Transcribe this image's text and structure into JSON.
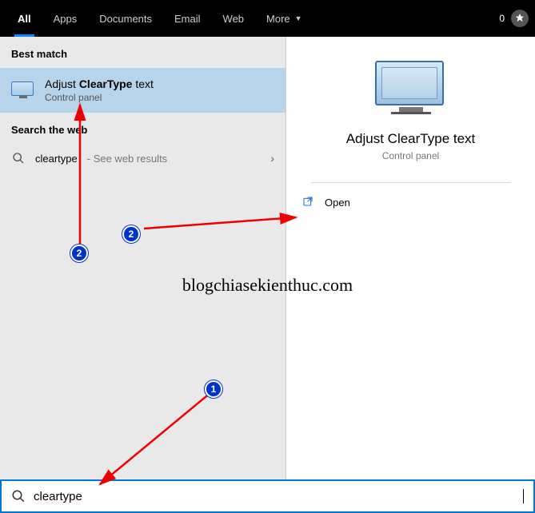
{
  "nav": {
    "tabs": [
      "All",
      "Apps",
      "Documents",
      "Email",
      "Web",
      "More"
    ],
    "active_index": 0,
    "count": "0"
  },
  "left": {
    "best_match_header": "Best match",
    "best_match": {
      "title_pre": "Adjust ",
      "title_bold": "ClearType",
      "title_post": " text",
      "subtitle": "Control panel"
    },
    "web_header": "Search the web",
    "web_row": {
      "query": "cleartype",
      "suffix": " - See web results"
    }
  },
  "right": {
    "title": "Adjust ClearType text",
    "subtitle": "Control panel",
    "open_label": "Open"
  },
  "search": {
    "value": "cleartype",
    "placeholder": ""
  },
  "annotations": {
    "marker1": "1",
    "marker2a": "2",
    "marker2b": "2",
    "watermark": "blogchiasekienthuc.com"
  }
}
